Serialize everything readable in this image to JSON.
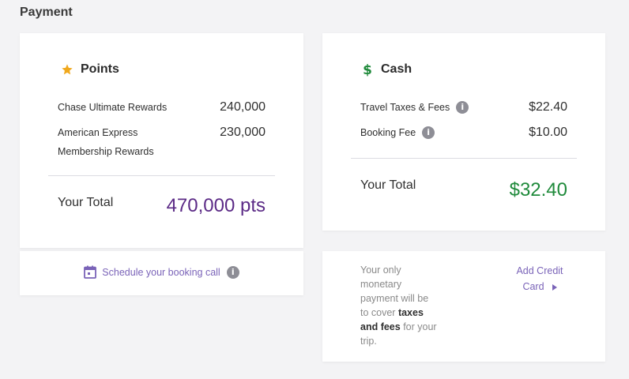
{
  "page": {
    "title": "Payment"
  },
  "points": {
    "heading": "Points",
    "icon": "star-icon",
    "icon_color": "#f0a81c",
    "lines": [
      {
        "label": "Chase Ultimate Rewards",
        "value": "240,000"
      },
      {
        "label_line1": "American Express",
        "label_line2": "Membership Rewards",
        "value": "230,000"
      }
    ],
    "total_label": "Your Total",
    "total_value": "470,000 pts",
    "total_color": "#5b2a86"
  },
  "cash": {
    "heading": "Cash",
    "icon": "dollar-icon",
    "icon_color": "#1f8a3b",
    "lines": [
      {
        "label": "Travel Taxes & Fees",
        "value": "$22.40",
        "info_icon": "info-icon"
      },
      {
        "label": "Booking Fee",
        "value": "$10.00",
        "info_icon": "info-icon"
      }
    ],
    "total_label": "Your Total",
    "total_value": "$32.40",
    "total_color": "#1f8a3b"
  },
  "schedule": {
    "label": "Schedule your booking call",
    "icon": "calendar-icon",
    "info_icon": "info-icon"
  },
  "note": {
    "text_before": "Your only monetary payment will be to cover ",
    "bold_text": "taxes and fees",
    "text_after": " for your trip.",
    "add_card_label_line1": "Add Credit",
    "add_card_label_line2": "Card",
    "add_card_icon": "play-icon"
  },
  "colors": {
    "accent": "#7a63b8",
    "background": "#f3f3f5",
    "info_icon": "#8e8e96"
  }
}
